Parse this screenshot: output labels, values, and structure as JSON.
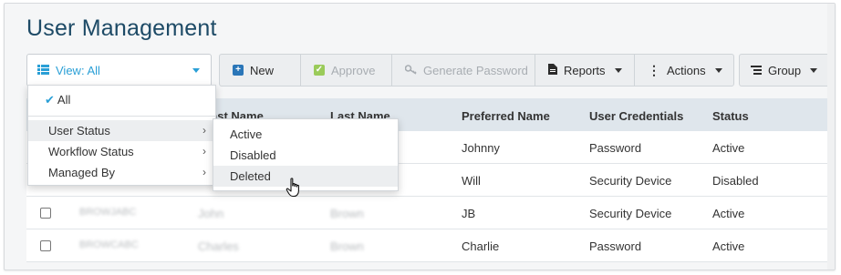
{
  "page_title": "User Management",
  "toolbar": {
    "view_label": "View: All",
    "new_label": "New",
    "approve_label": "Approve",
    "generate_password_label": "Generate Password",
    "reports_label": "Reports",
    "actions_label": "Actions",
    "group_label": "Group"
  },
  "colors": {
    "accent": "#2a9fd6",
    "title": "#1d4a66",
    "approve": "#8cc63f",
    "new": "#2a76b8"
  },
  "table": {
    "headers": [
      "Last Name",
      "Last Name",
      "Preferred Name",
      "User Credentials",
      "Status"
    ],
    "header_visible_partial": "ast Name",
    "rows": [
      {
        "username": "",
        "first": "",
        "last": "",
        "preferred": "Johnny",
        "credentials": "Password",
        "status": "Active"
      },
      {
        "username": "",
        "first": "",
        "last": "",
        "preferred": "Will",
        "credentials": "Security Device",
        "status": "Disabled"
      },
      {
        "username": "BROWJABC",
        "first": "John",
        "last": "Brown",
        "preferred": "JB",
        "credentials": "Security Device",
        "status": "Active"
      },
      {
        "username": "BROWCABC",
        "first": "Charles",
        "last": "Brown",
        "preferred": "Charlie",
        "credentials": "Password",
        "status": "Active"
      }
    ]
  },
  "view_menu": {
    "items": [
      "All",
      "User Status",
      "Workflow Status",
      "Managed By"
    ],
    "chevron": "›"
  },
  "status_submenu": {
    "items": [
      "Active",
      "Disabled",
      "Deleted"
    ]
  }
}
